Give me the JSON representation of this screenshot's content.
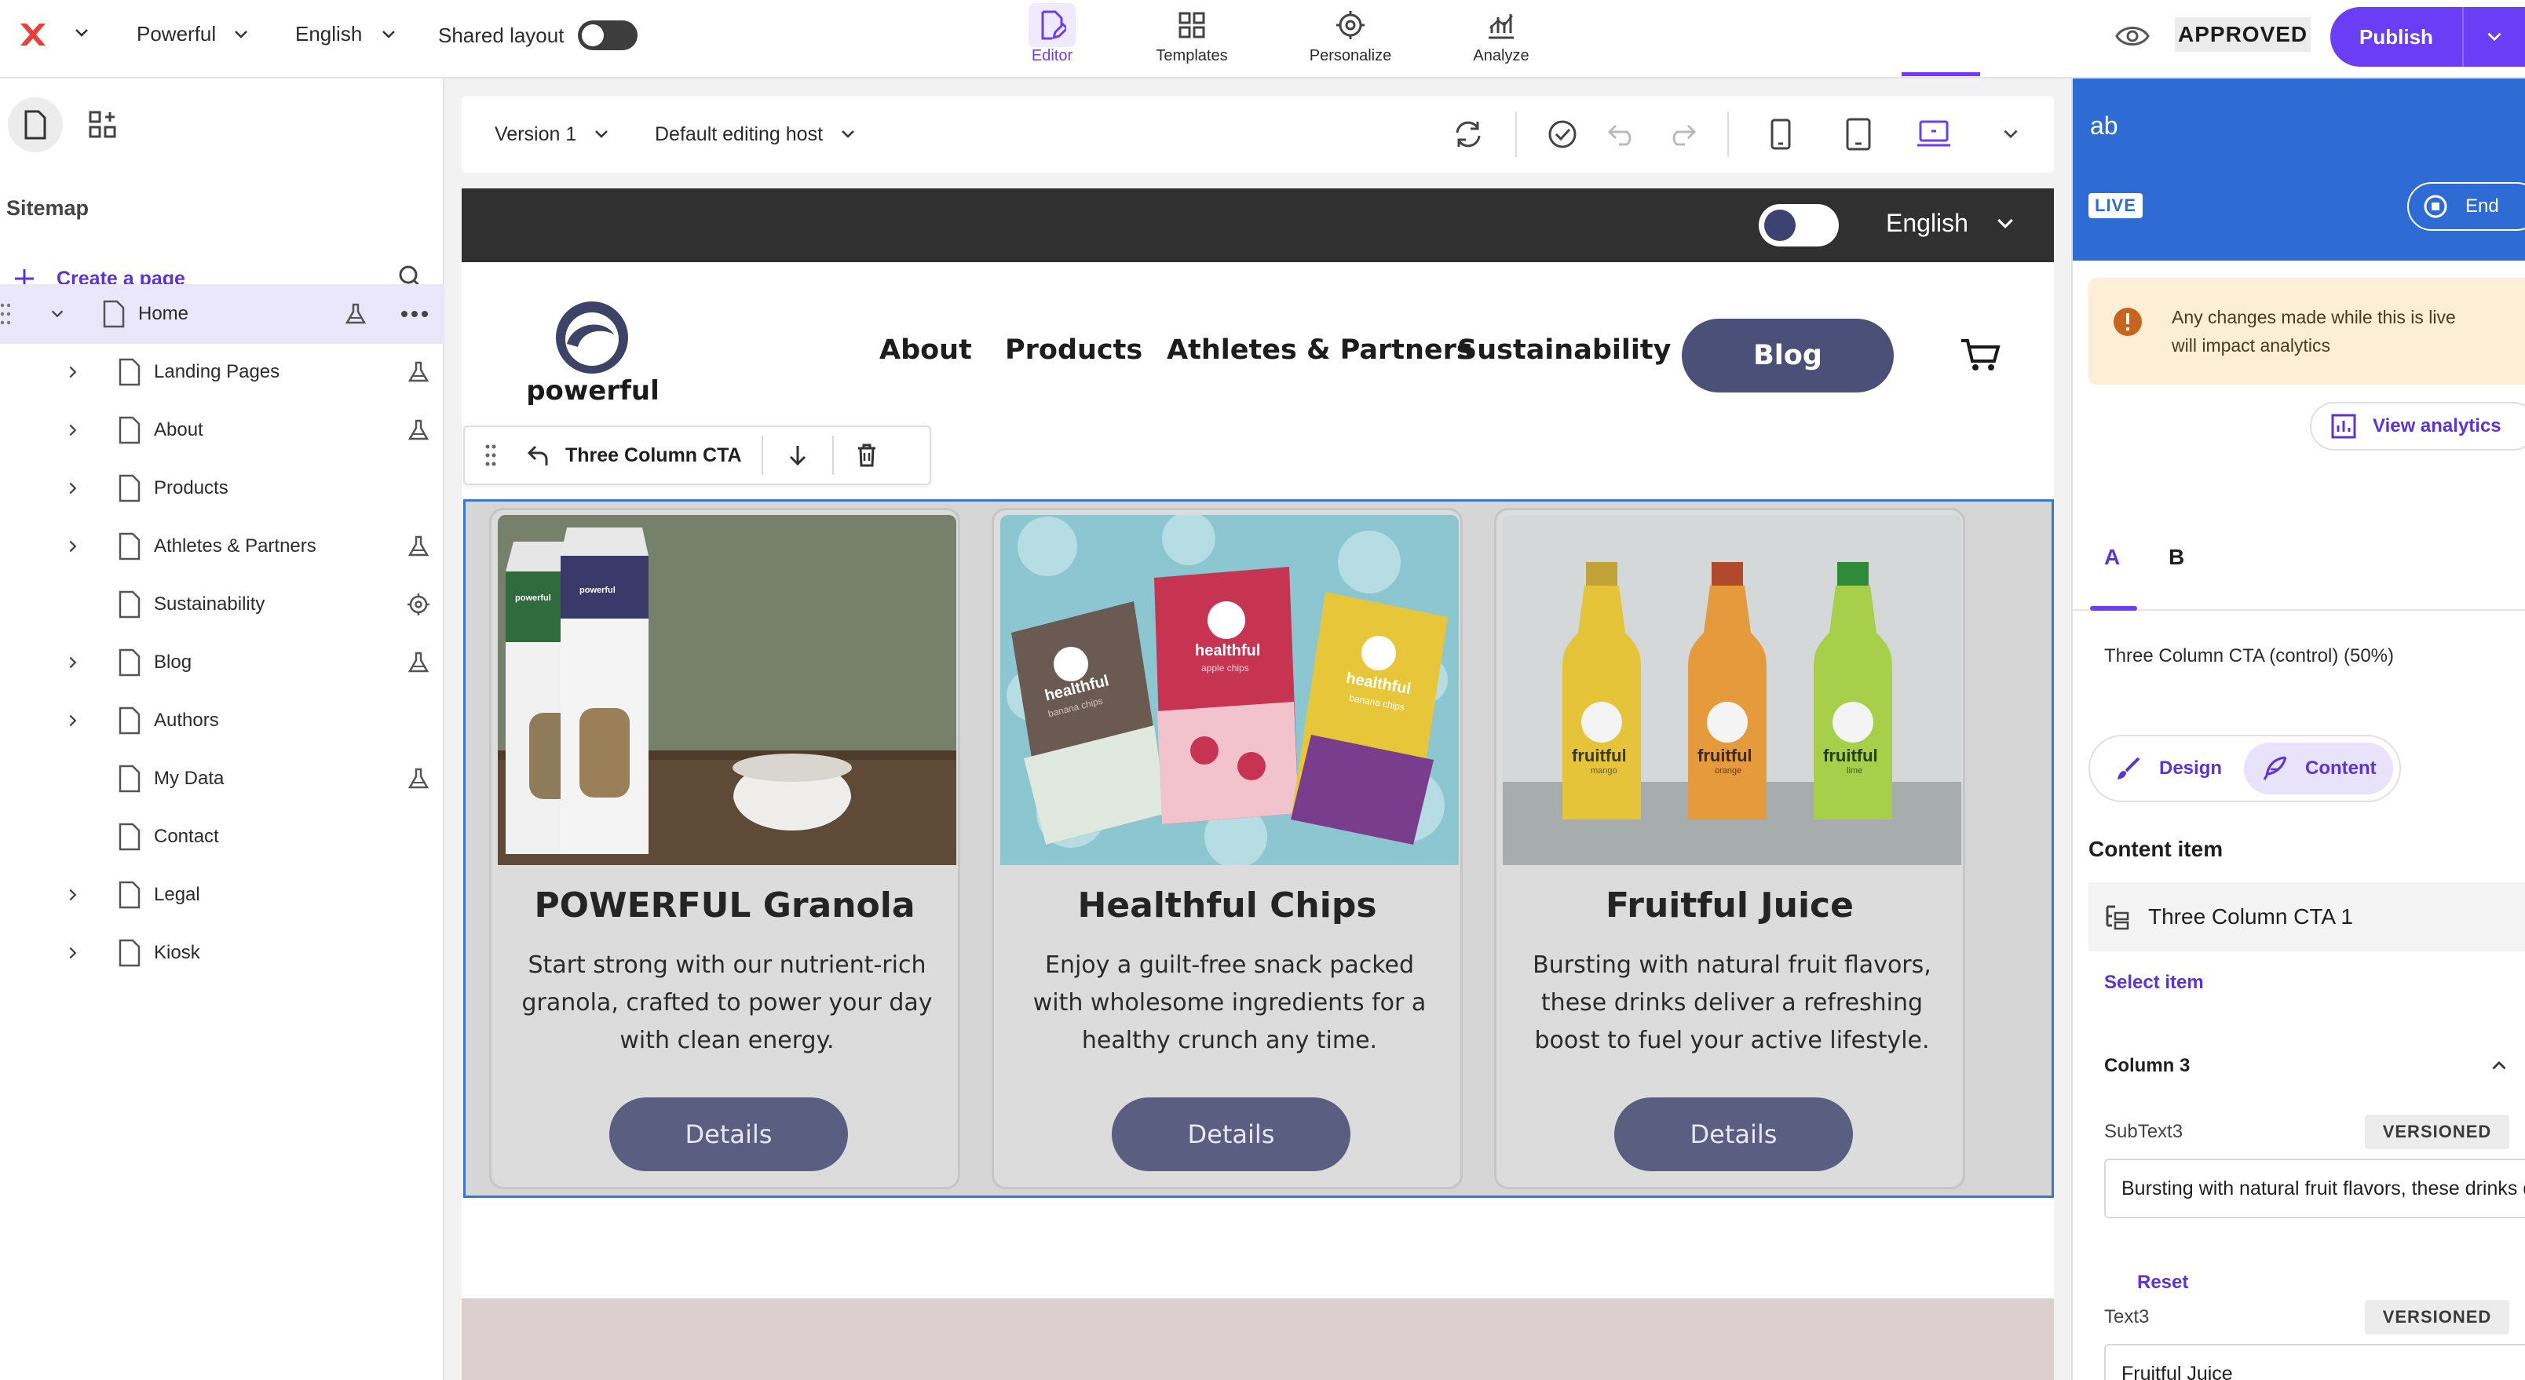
{
  "topbar": {
    "site": "Powerful",
    "language": "English",
    "shared_layout_label": "Shared layout",
    "modes": [
      {
        "label": "Editor"
      },
      {
        "label": "Templates"
      },
      {
        "label": "Personalize"
      },
      {
        "label": "Analyze"
      }
    ],
    "status": "APPROVED",
    "publish_label": "Publish"
  },
  "sidebar": {
    "title": "Sitemap",
    "create_page": "Create a page",
    "items": [
      {
        "label": "Home"
      },
      {
        "label": "Landing Pages"
      },
      {
        "label": "About"
      },
      {
        "label": "Products"
      },
      {
        "label": "Athletes & Partners"
      },
      {
        "label": "Sustainability"
      },
      {
        "label": "Blog"
      },
      {
        "label": "Authors"
      },
      {
        "label": "My Data"
      },
      {
        "label": "Contact"
      },
      {
        "label": "Legal"
      },
      {
        "label": "Kiosk"
      }
    ]
  },
  "editor_toolbar": {
    "version": "Version 1",
    "host": "Default editing host"
  },
  "site": {
    "language": "English",
    "logo_text": "powerful",
    "nav": [
      "About",
      "Products",
      "Athletes & Partners",
      "Sustainability"
    ],
    "blog_button": "Blog",
    "component_name": "Three Column CTA",
    "cards": [
      {
        "title": "POWERFUL Granola",
        "text": "Start strong with our nutrient-rich granola, crafted to power your day with clean energy.",
        "button": "Details"
      },
      {
        "title": "Healthful Chips",
        "text": "Enjoy a guilt-free snack packed with wholesome ingredients for a healthy crunch any time.",
        "button": "Details"
      },
      {
        "title": "Fruitful Juice",
        "text": "Bursting with natural fruit flavors, these drinks deliver a refreshing boost to fuel your active lifestyle.",
        "button": "Details"
      }
    ],
    "product_labels": {
      "bag": "powerful",
      "chips": "healthful",
      "chips_sub": [
        "banana chips",
        "apple chips",
        "banana chips"
      ],
      "juice": "fruitful",
      "juice_sub": [
        "mango",
        "orange",
        "lime"
      ]
    }
  },
  "panel": {
    "title": "ab",
    "live": "LIVE",
    "end": "End",
    "warning": "Any changes made while this is live will impact analytics",
    "view_analytics": "View analytics",
    "tab_a": "A",
    "tab_b": "B",
    "variant": "Three Column CTA (control)  (50%)",
    "design": "Design",
    "content": "Content",
    "content_item_title": "Content item",
    "content_item": "Three Column CTA 1",
    "select_item": "Select item",
    "column": "Column 3",
    "subtext_label": "SubText3",
    "subtext_value": "Bursting with natural fruit flavors, these drinks deliver a refreshing boost to fuel your active lifestyle.",
    "versioned": "VERSIONED",
    "reset": "Reset",
    "text_label": "Text3",
    "text_value": "Fruitful Juice"
  },
  "colors": {
    "accent": "#6b3df5",
    "panel_header": "#2f6bd5",
    "site_button": "#4a5078"
  }
}
